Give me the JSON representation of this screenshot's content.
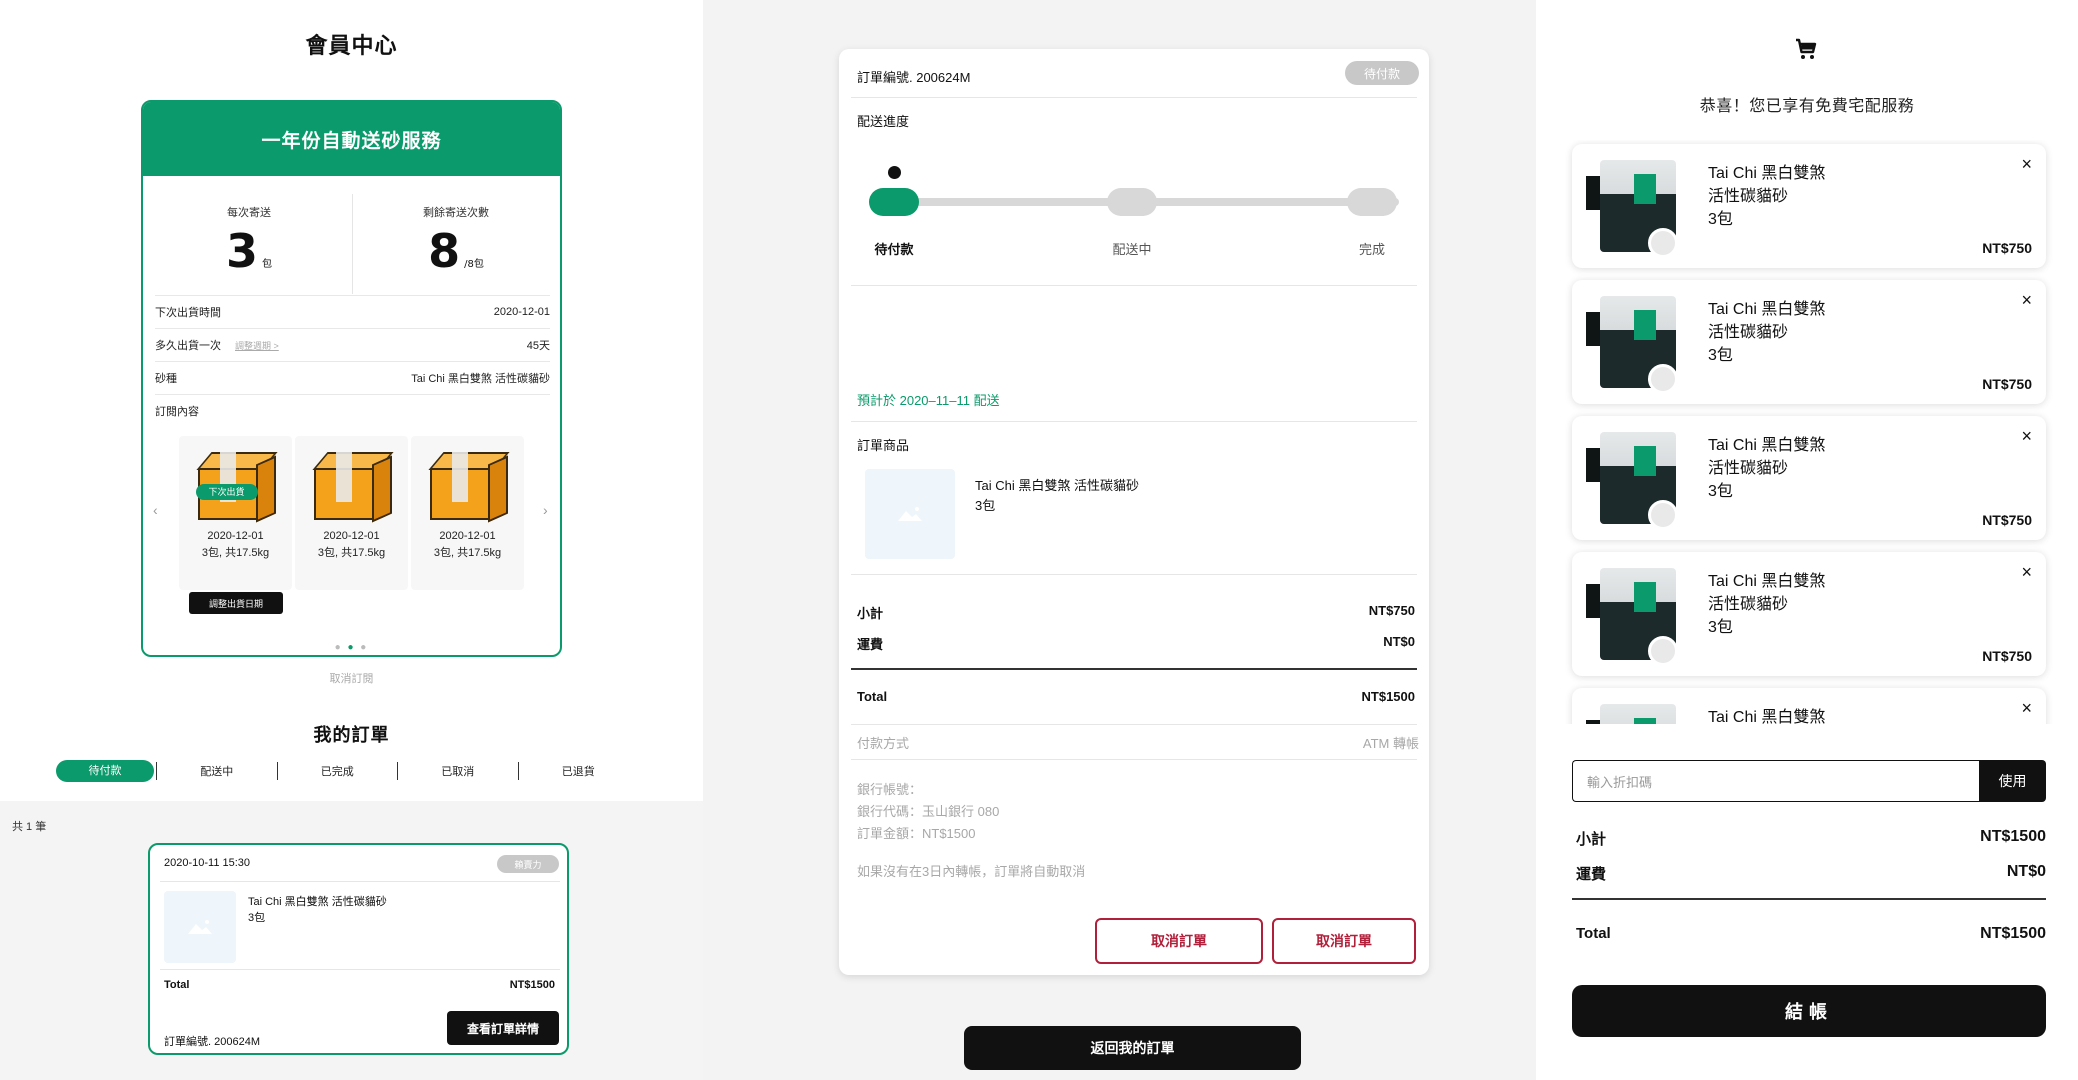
{
  "member_center": {
    "title": "會員中心",
    "subscription": {
      "header": "一年份自動送砂服務",
      "per_delivery_label": "每次寄送",
      "per_delivery_value": "3",
      "per_delivery_unit": "包",
      "remaining_label": "剩餘寄送次數",
      "remaining_value": "8",
      "remaining_unit": "/8包",
      "rows": [
        {
          "label": "下次出貨時間",
          "value": "2020-12-01"
        },
        {
          "label": "多久出貨一次",
          "link": "調整週期 >",
          "value": "45天"
        },
        {
          "label": "砂種",
          "value": "Tai Chi 黑白雙煞 活性碳貓砂"
        },
        {
          "label": "訂閱內容",
          "value": ""
        }
      ],
      "shipments": [
        {
          "tag": "下次出貨",
          "date": "2020-12-01",
          "qty": "3包, 共17.5kg"
        },
        {
          "tag": "",
          "date": "2020-12-01",
          "qty": "3包, 共17.5kg"
        },
        {
          "tag": "",
          "date": "2020-12-01",
          "qty": "3包, 共17.5kg"
        }
      ],
      "adjust_button": "調整出貨日期",
      "prev_arrow": "‹",
      "next_arrow": "›"
    },
    "cancel_subscription": "取消訂閱",
    "orders_title": "我的訂單",
    "tabs": [
      "待付款",
      "配送中",
      "已完成",
      "已取消",
      "已退貨"
    ],
    "count_text": "共 1 筆",
    "order": {
      "datetime": "2020-10-11 15:30",
      "badge": "賴賣力",
      "product_name": "Tai Chi 黑白雙煞 活性碳貓砂",
      "product_qty": "3包",
      "total_label": "Total",
      "total_value": "NT$1500",
      "order_no": "訂單編號. 200624M",
      "detail_button": "查看訂單詳情"
    }
  },
  "order_detail": {
    "order_no": "訂單編號. 200624M",
    "status_badge": "待付款",
    "progress_title": "配送進度",
    "progress": {
      "steps": [
        "待付款",
        "配送中",
        "完成"
      ],
      "current_step": 1
    },
    "expected": "預計於 2020–11–11 配送",
    "items_title": "訂單商品",
    "item_name": "Tai Chi 黑白雙煞 活性碳貓砂",
    "item_qty": "3包",
    "subtotal_label": "小計",
    "subtotal_value": "NT$750",
    "shipping_label": "運費",
    "shipping_value": "NT$0",
    "total_label": "Total",
    "total_value": "NT$1500",
    "payment_label": "付款方式",
    "payment_value": "ATM 轉帳",
    "bank_account": "銀行帳號：",
    "bank_code": "銀行代碼：玉山銀行 080",
    "amount": "訂單金額：NT$1500",
    "notice": "如果沒有在3日內轉帳，訂單將自動取消",
    "cancel_button_1": "取消訂單",
    "cancel_button_2": "取消訂單",
    "back_button": "返回我的訂單"
  },
  "cart": {
    "icon": "shopping-cart-icon",
    "message": "恭喜！您已享有免費宅配服務",
    "items": [
      {
        "name_line1": "Tai Chi 黑白雙煞",
        "name_line2": "活性碳貓砂",
        "qty": "3包",
        "price": "NT$750"
      },
      {
        "name_line1": "Tai Chi 黑白雙煞",
        "name_line2": "活性碳貓砂",
        "qty": "3包",
        "price": "NT$750"
      },
      {
        "name_line1": "Tai Chi 黑白雙煞",
        "name_line2": "活性碳貓砂",
        "qty": "3包",
        "price": "NT$750"
      },
      {
        "name_line1": "Tai Chi 黑白雙煞",
        "name_line2": "活性碳貓砂",
        "qty": "3包",
        "price": "NT$750"
      },
      {
        "name_line1": "Tai Chi 黑白雙煞",
        "name_line2": "",
        "qty": "",
        "price": ""
      }
    ],
    "close_symbol": "×",
    "coupon_placeholder": "輸入折扣碼",
    "coupon_button": "使用",
    "subtotal_label": "小計",
    "subtotal_value": "NT$1500",
    "shipping_label": "運費",
    "shipping_value": "NT$0",
    "total_label": "Total",
    "total_value": "NT$1500",
    "checkout_button": "結帳",
    "colors": {
      "brand_green": "#0b9a6b",
      "danger": "#b0203a",
      "dark": "#111111"
    }
  }
}
